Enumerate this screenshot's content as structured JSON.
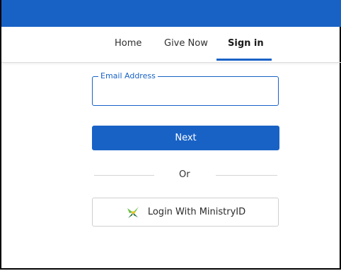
{
  "colors": {
    "brand_blue": "#1862c6",
    "icon_green": "#6cc04a",
    "icon_dark_green": "#1f6f3a",
    "icon_yellow": "#f0c419"
  },
  "nav": {
    "items": [
      {
        "label": "Home"
      },
      {
        "label": "Give Now"
      },
      {
        "label": "Sign in",
        "active": true
      }
    ]
  },
  "form": {
    "email_label": "Email Address",
    "email_value": "",
    "next_label": "Next",
    "divider_text": "Or",
    "ministry_login_label": "Login With MinistryID",
    "ministry_icon": "ministryid-logo-icon"
  }
}
